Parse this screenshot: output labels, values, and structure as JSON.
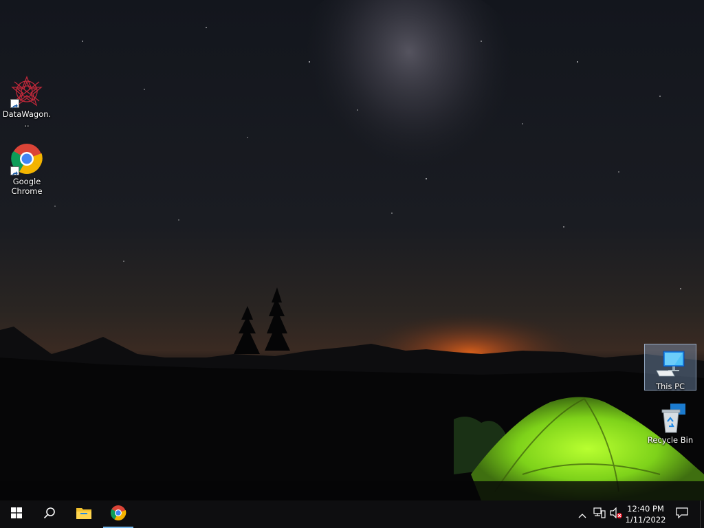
{
  "desktop": {
    "icons": [
      {
        "label": "DataWagon..."
      },
      {
        "label": "Google Chrome"
      },
      {
        "label": "This PC"
      },
      {
        "label": "Recycle Bin"
      }
    ]
  },
  "taskbar": {
    "start_icon": "windows-logo-icon",
    "search_icon": "search-icon",
    "pinned": [
      "file-explorer-icon",
      "chrome-icon"
    ],
    "tray": {
      "icons": [
        "chevron-up-icon",
        "network-icon",
        "volume-muted-icon"
      ],
      "time": "12:40 PM",
      "date": "1/11/2022",
      "notification_icon": "action-center-icon"
    }
  },
  "colors": {
    "taskbar": "#0e0e10",
    "accent": "#76b9ed",
    "tent": "#9be21f"
  }
}
